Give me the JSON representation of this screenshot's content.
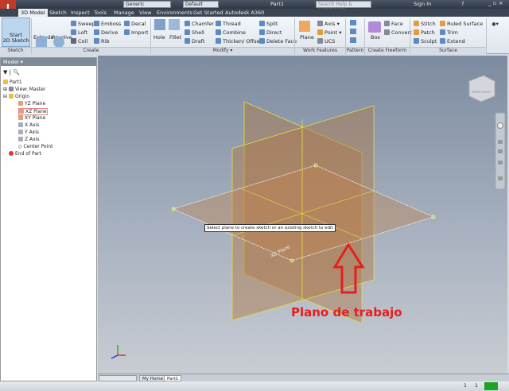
{
  "app": {
    "document_title": "Part1",
    "search_placeholder": "Search Help & Commands...",
    "sign_in": "Sign In",
    "material": "Generic",
    "appearance": "Default"
  },
  "tabs": [
    "3D Model",
    "Sketch",
    "Inspect",
    "Tools",
    "Manage",
    "View",
    "Environments",
    "Get Started",
    "Autodesk A360"
  ],
  "ribbon": {
    "sketch": {
      "start": "Start",
      "start2": "2D Sketch",
      "group": "Sketch"
    },
    "create": {
      "items": [
        "Extrude",
        "Revolve",
        "Sweep",
        "Loft",
        "Coil",
        "Emboss",
        "Derive",
        "Rib",
        "Decal",
        "Import"
      ],
      "group": "Create"
    },
    "modify": {
      "items": [
        "Hole",
        "Fillet",
        "Chamfer",
        "Shell",
        "Draft",
        "Thread",
        "Combine",
        "Thicken/ Offset",
        "Split",
        "Direct",
        "Delete Face"
      ],
      "group": "Modify ▾"
    },
    "work": {
      "items": [
        "Plane",
        "Axis",
        "Point",
        "UCS"
      ],
      "group": "Work Features"
    },
    "pattern": {
      "group": "Pattern"
    },
    "freeform": {
      "items": [
        "Box",
        "Face",
        "Convert"
      ],
      "group": "Create Freeform"
    },
    "surface": {
      "items": [
        "Stitch",
        "Patch",
        "Sculpt",
        "Ruled Surface",
        "Trim",
        "Extend"
      ],
      "group": "Surface"
    }
  },
  "browser": {
    "title": "Model ▾",
    "items": [
      "Part1",
      "View: Master",
      "Origin",
      "YZ Plane",
      "XZ Plane",
      "XY Plane",
      "X Axis",
      "Y Axis",
      "Z Axis",
      "Center Point",
      "End of Part"
    ]
  },
  "viewport": {
    "tooltip": "Select plane to create sketch or an existing sketch to edit",
    "plane_label": "XZ Plane",
    "annotation": "Plano de trabajo",
    "viewcube": "FRONT RIGHT",
    "annotation_color": "#e41f1f"
  },
  "doc_tabs": [
    "My Home",
    "Part1"
  ],
  "status": {
    "a": "1",
    "b": "1"
  }
}
